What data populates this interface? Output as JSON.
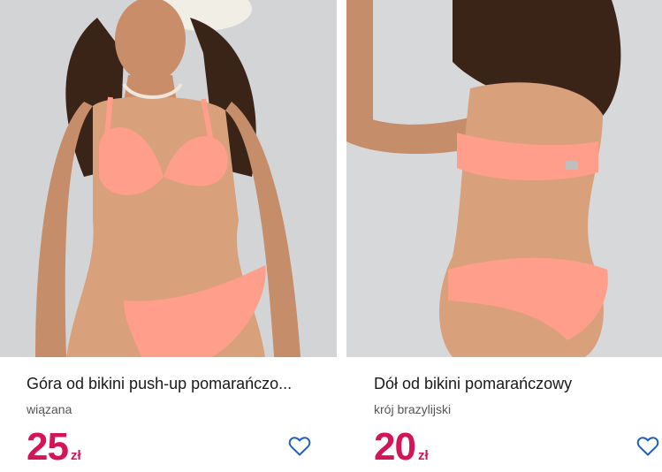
{
  "products": [
    {
      "title": "Góra od bikini push-up pomarańczo...",
      "subtitle": "wiązana",
      "price": "25",
      "currency": "zł",
      "image_icon": "bikini-top-photo",
      "favorite_icon": "heart-outline-icon"
    },
    {
      "title": "Dół od bikini pomarańczowy",
      "subtitle": "krój brazylijski",
      "price": "20",
      "currency": "zł",
      "image_icon": "bikini-bottom-photo",
      "favorite_icon": "heart-outline-icon"
    }
  ],
  "colors": {
    "price": "#d4145a",
    "heart": "#1f5fbf",
    "bikini": "#ff9e8a",
    "skin": "#d9a07c",
    "backdrop": "#d7d8da"
  }
}
